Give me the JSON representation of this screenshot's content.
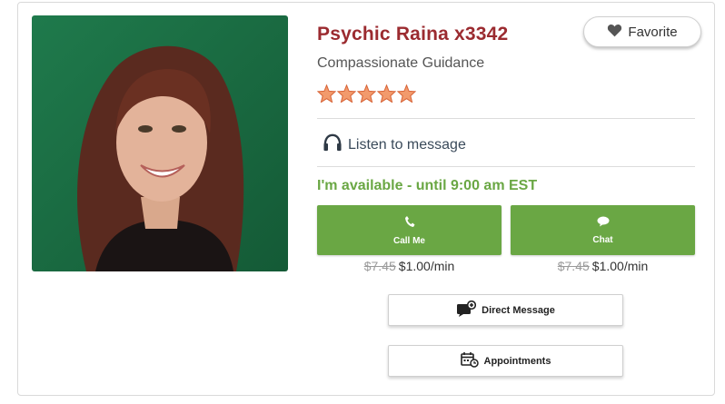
{
  "profile": {
    "name": "Psychic Raina x3342",
    "tagline": "Compassionate Guidance",
    "rating_stars": 5,
    "favorite_label": "Favorite",
    "listen_label": "Listen to message",
    "availability": "I'm available - until 9:00 am EST"
  },
  "actions": {
    "call": {
      "label": "Call Me",
      "old_price": "$7.45",
      "price": "$1.00/min"
    },
    "chat": {
      "label": "Chat",
      "old_price": "$7.45",
      "price": "$1.00/min"
    },
    "direct_message_label": "Direct Message",
    "appointments_label": "Appointments"
  },
  "colors": {
    "name": "#9b2b30",
    "available_green": "#6aa744",
    "star": "#f29a6c"
  },
  "icons": [
    "heart-icon",
    "headphones-icon",
    "phone-icon",
    "chat-bubble-icon",
    "message-icon",
    "calendar-icon",
    "star-icon"
  ]
}
